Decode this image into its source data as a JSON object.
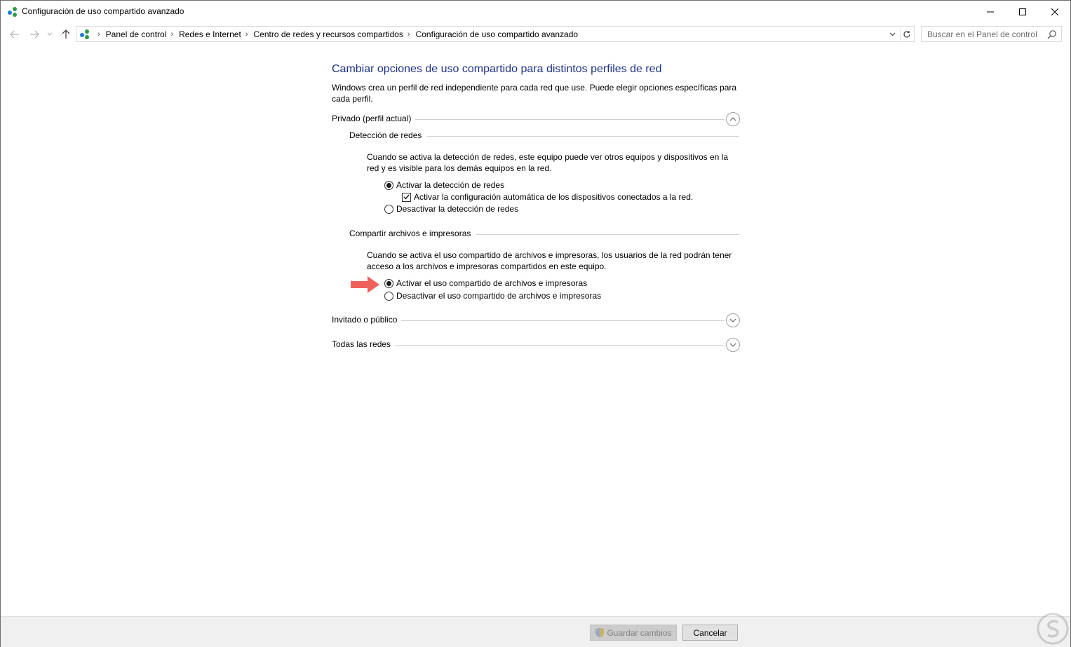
{
  "window": {
    "title": "Configuración de uso compartido avanzado",
    "app_icon": "network-sharing-icon"
  },
  "nav": {
    "breadcrumbs": [
      "Panel de control",
      "Redes e Internet",
      "Centro de redes y recursos compartidos",
      "Configuración de uso compartido avanzado"
    ],
    "search_placeholder": "Buscar en el Panel de control"
  },
  "main": {
    "title": "Cambiar opciones de uso compartido para distintos perfiles de red",
    "description": "Windows crea un perfil de red independiente para cada red que use. Puede elegir opciones específicas para cada perfil.",
    "profiles": {
      "private": {
        "label": "Privado (perfil actual)",
        "expanded": true,
        "network_discovery": {
          "heading": "Detección de redes",
          "description": "Cuando se activa la detección de redes, este equipo puede ver otros equipos y dispositivos en la red y es visible para los demás equipos en la red.",
          "on_label": "Activar la detección de redes",
          "auto_setup_label": "Activar la configuración automática de los dispositivos conectados a la red.",
          "off_label": "Desactivar la detección de redes",
          "selected": "on",
          "auto_setup_checked": true
        },
        "file_sharing": {
          "heading": "Compartir archivos e impresoras",
          "description": "Cuando se activa el uso compartido de archivos e impresoras, los usuarios de la red podrán tener acceso a los archivos e impresoras compartidos en este equipo.",
          "on_label": "Activar el uso compartido de archivos e impresoras",
          "off_label": "Desactivar el uso compartido de archivos e impresoras",
          "selected": "on"
        }
      },
      "guest": {
        "label": "Invitado o público",
        "expanded": false
      },
      "all": {
        "label": "Todas las redes",
        "expanded": false
      }
    }
  },
  "footer": {
    "save_label": "Guardar cambios",
    "cancel_label": "Cancelar",
    "save_enabled": false
  },
  "colors": {
    "title_blue": "#1e3287",
    "pointer_arrow": "#f0605a"
  }
}
